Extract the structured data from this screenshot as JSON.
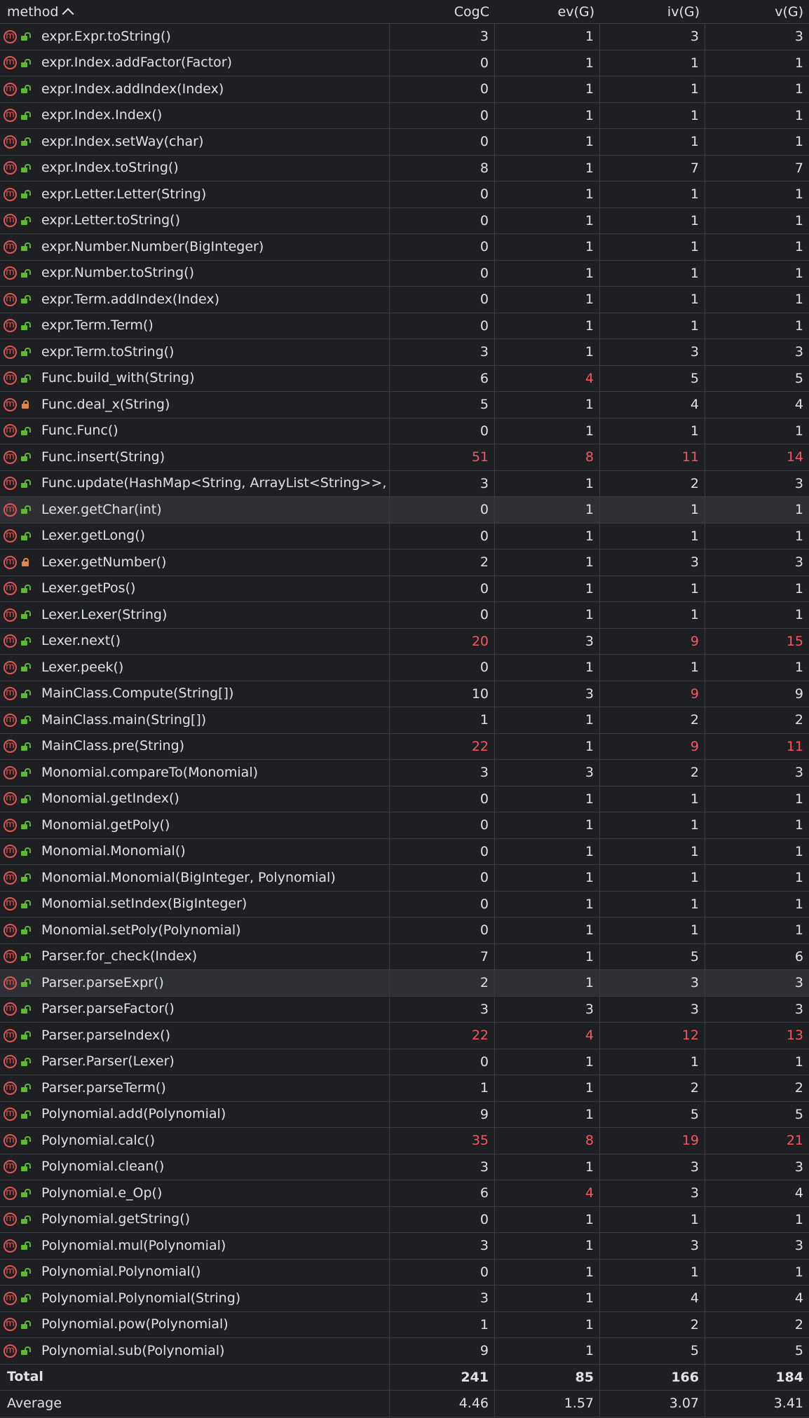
{
  "header": {
    "method": "method",
    "cogc": "CogC",
    "ev": "ev(G)",
    "iv": "iv(G)",
    "v": "v(G)"
  },
  "colors": {
    "background": "#1e1f22",
    "grid": "#393b40",
    "text": "#dfe1e5",
    "warning": "#f75464",
    "public_icon": "#5fb832",
    "private_icon": "#e0854a",
    "method_icon": "#e05555"
  },
  "rows": [
    {
      "method": "expr.Expr.toString()",
      "vis": "public",
      "cogc": "3",
      "ev": "1",
      "iv": "3",
      "v": "3",
      "red": []
    },
    {
      "method": "expr.Index.addFactor(Factor)",
      "vis": "public",
      "cogc": "0",
      "ev": "1",
      "iv": "1",
      "v": "1",
      "red": []
    },
    {
      "method": "expr.Index.addIndex(Index)",
      "vis": "public",
      "cogc": "0",
      "ev": "1",
      "iv": "1",
      "v": "1",
      "red": []
    },
    {
      "method": "expr.Index.Index()",
      "vis": "public",
      "cogc": "0",
      "ev": "1",
      "iv": "1",
      "v": "1",
      "red": []
    },
    {
      "method": "expr.Index.setWay(char)",
      "vis": "public",
      "cogc": "0",
      "ev": "1",
      "iv": "1",
      "v": "1",
      "red": []
    },
    {
      "method": "expr.Index.toString()",
      "vis": "public",
      "cogc": "8",
      "ev": "1",
      "iv": "7",
      "v": "7",
      "red": []
    },
    {
      "method": "expr.Letter.Letter(String)",
      "vis": "public",
      "cogc": "0",
      "ev": "1",
      "iv": "1",
      "v": "1",
      "red": []
    },
    {
      "method": "expr.Letter.toString()",
      "vis": "public",
      "cogc": "0",
      "ev": "1",
      "iv": "1",
      "v": "1",
      "red": []
    },
    {
      "method": "expr.Number.Number(BigInteger)",
      "vis": "public",
      "cogc": "0",
      "ev": "1",
      "iv": "1",
      "v": "1",
      "red": []
    },
    {
      "method": "expr.Number.toString()",
      "vis": "public",
      "cogc": "0",
      "ev": "1",
      "iv": "1",
      "v": "1",
      "red": []
    },
    {
      "method": "expr.Term.addIndex(Index)",
      "vis": "public",
      "cogc": "0",
      "ev": "1",
      "iv": "1",
      "v": "1",
      "red": []
    },
    {
      "method": "expr.Term.Term()",
      "vis": "public",
      "cogc": "0",
      "ev": "1",
      "iv": "1",
      "v": "1",
      "red": []
    },
    {
      "method": "expr.Term.toString()",
      "vis": "public",
      "cogc": "3",
      "ev": "1",
      "iv": "3",
      "v": "3",
      "red": []
    },
    {
      "method": "Func.build_with(String)",
      "vis": "public",
      "cogc": "6",
      "ev": "4",
      "iv": "5",
      "v": "5",
      "red": [
        "ev"
      ]
    },
    {
      "method": "Func.deal_x(String)",
      "vis": "private",
      "cogc": "5",
      "ev": "1",
      "iv": "4",
      "v": "4",
      "red": []
    },
    {
      "method": "Func.Func()",
      "vis": "public",
      "cogc": "0",
      "ev": "1",
      "iv": "1",
      "v": "1",
      "red": []
    },
    {
      "method": "Func.insert(String)",
      "vis": "public",
      "cogc": "51",
      "ev": "8",
      "iv": "11",
      "v": "14",
      "red": [
        "cogc",
        "ev",
        "iv",
        "v"
      ]
    },
    {
      "method": "Func.update(HashMap<String, ArrayList<String>>, Str",
      "vis": "public",
      "cogc": "3",
      "ev": "1",
      "iv": "2",
      "v": "3",
      "red": []
    },
    {
      "method": "Lexer.getChar(int)",
      "vis": "public",
      "cogc": "0",
      "ev": "1",
      "iv": "1",
      "v": "1",
      "red": [],
      "selected": true
    },
    {
      "method": "Lexer.getLong()",
      "vis": "public",
      "cogc": "0",
      "ev": "1",
      "iv": "1",
      "v": "1",
      "red": []
    },
    {
      "method": "Lexer.getNumber()",
      "vis": "private",
      "cogc": "2",
      "ev": "1",
      "iv": "3",
      "v": "3",
      "red": []
    },
    {
      "method": "Lexer.getPos()",
      "vis": "public",
      "cogc": "0",
      "ev": "1",
      "iv": "1",
      "v": "1",
      "red": []
    },
    {
      "method": "Lexer.Lexer(String)",
      "vis": "public",
      "cogc": "0",
      "ev": "1",
      "iv": "1",
      "v": "1",
      "red": []
    },
    {
      "method": "Lexer.next()",
      "vis": "public",
      "cogc": "20",
      "ev": "3",
      "iv": "9",
      "v": "15",
      "red": [
        "cogc",
        "iv",
        "v"
      ]
    },
    {
      "method": "Lexer.peek()",
      "vis": "public",
      "cogc": "0",
      "ev": "1",
      "iv": "1",
      "v": "1",
      "red": []
    },
    {
      "method": "MainClass.Compute(String[])",
      "vis": "public",
      "cogc": "10",
      "ev": "3",
      "iv": "9",
      "v": "9",
      "red": [
        "iv"
      ]
    },
    {
      "method": "MainClass.main(String[])",
      "vis": "public",
      "cogc": "1",
      "ev": "1",
      "iv": "2",
      "v": "2",
      "red": []
    },
    {
      "method": "MainClass.pre(String)",
      "vis": "public",
      "cogc": "22",
      "ev": "1",
      "iv": "9",
      "v": "11",
      "red": [
        "cogc",
        "iv",
        "v"
      ]
    },
    {
      "method": "Monomial.compareTo(Monomial)",
      "vis": "public",
      "cogc": "3",
      "ev": "3",
      "iv": "2",
      "v": "3",
      "red": []
    },
    {
      "method": "Monomial.getIndex()",
      "vis": "public",
      "cogc": "0",
      "ev": "1",
      "iv": "1",
      "v": "1",
      "red": []
    },
    {
      "method": "Monomial.getPoly()",
      "vis": "public",
      "cogc": "0",
      "ev": "1",
      "iv": "1",
      "v": "1",
      "red": []
    },
    {
      "method": "Monomial.Monomial()",
      "vis": "public",
      "cogc": "0",
      "ev": "1",
      "iv": "1",
      "v": "1",
      "red": []
    },
    {
      "method": "Monomial.Monomial(BigInteger, Polynomial)",
      "vis": "public",
      "cogc": "0",
      "ev": "1",
      "iv": "1",
      "v": "1",
      "red": []
    },
    {
      "method": "Monomial.setIndex(BigInteger)",
      "vis": "public",
      "cogc": "0",
      "ev": "1",
      "iv": "1",
      "v": "1",
      "red": []
    },
    {
      "method": "Monomial.setPoly(Polynomial)",
      "vis": "public",
      "cogc": "0",
      "ev": "1",
      "iv": "1",
      "v": "1",
      "red": []
    },
    {
      "method": "Parser.for_check(Index)",
      "vis": "public",
      "cogc": "7",
      "ev": "1",
      "iv": "5",
      "v": "6",
      "red": []
    },
    {
      "method": "Parser.parseExpr()",
      "vis": "public",
      "cogc": "2",
      "ev": "1",
      "iv": "3",
      "v": "3",
      "red": [],
      "selected": true
    },
    {
      "method": "Parser.parseFactor()",
      "vis": "public",
      "cogc": "3",
      "ev": "3",
      "iv": "3",
      "v": "3",
      "red": []
    },
    {
      "method": "Parser.parseIndex()",
      "vis": "public",
      "cogc": "22",
      "ev": "4",
      "iv": "12",
      "v": "13",
      "red": [
        "cogc",
        "ev",
        "iv",
        "v"
      ]
    },
    {
      "method": "Parser.Parser(Lexer)",
      "vis": "public",
      "cogc": "0",
      "ev": "1",
      "iv": "1",
      "v": "1",
      "red": []
    },
    {
      "method": "Parser.parseTerm()",
      "vis": "public",
      "cogc": "1",
      "ev": "1",
      "iv": "2",
      "v": "2",
      "red": []
    },
    {
      "method": "Polynomial.add(Polynomial)",
      "vis": "public",
      "cogc": "9",
      "ev": "1",
      "iv": "5",
      "v": "5",
      "red": []
    },
    {
      "method": "Polynomial.calc()",
      "vis": "public",
      "cogc": "35",
      "ev": "8",
      "iv": "19",
      "v": "21",
      "red": [
        "cogc",
        "ev",
        "iv",
        "v"
      ]
    },
    {
      "method": "Polynomial.clean()",
      "vis": "public",
      "cogc": "3",
      "ev": "1",
      "iv": "3",
      "v": "3",
      "red": []
    },
    {
      "method": "Polynomial.e_Op()",
      "vis": "public",
      "cogc": "6",
      "ev": "4",
      "iv": "3",
      "v": "4",
      "red": [
        "ev"
      ]
    },
    {
      "method": "Polynomial.getString()",
      "vis": "public",
      "cogc": "0",
      "ev": "1",
      "iv": "1",
      "v": "1",
      "red": []
    },
    {
      "method": "Polynomial.mul(Polynomial)",
      "vis": "public",
      "cogc": "3",
      "ev": "1",
      "iv": "3",
      "v": "3",
      "red": []
    },
    {
      "method": "Polynomial.Polynomial()",
      "vis": "public",
      "cogc": "0",
      "ev": "1",
      "iv": "1",
      "v": "1",
      "red": []
    },
    {
      "method": "Polynomial.Polynomial(String)",
      "vis": "public",
      "cogc": "3",
      "ev": "1",
      "iv": "4",
      "v": "4",
      "red": []
    },
    {
      "method": "Polynomial.pow(Polynomial)",
      "vis": "public",
      "cogc": "1",
      "ev": "1",
      "iv": "2",
      "v": "2",
      "red": []
    },
    {
      "method": "Polynomial.sub(Polynomial)",
      "vis": "public",
      "cogc": "9",
      "ev": "1",
      "iv": "5",
      "v": "5",
      "red": []
    }
  ],
  "total": {
    "label": "Total",
    "cogc": "241",
    "ev": "85",
    "iv": "166",
    "v": "184"
  },
  "average": {
    "label": "Average",
    "cogc": "4.46",
    "ev": "1.57",
    "iv": "3.07",
    "v": "3.41"
  }
}
